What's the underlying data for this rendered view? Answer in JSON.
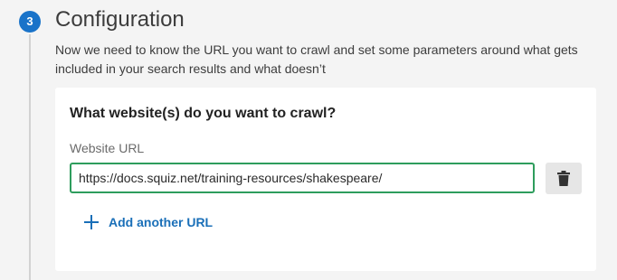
{
  "step": {
    "number": "3",
    "title": "Configuration",
    "description": "Now we need to know the URL you want to crawl and set some parameters around what gets included in your search results and what doesn’t"
  },
  "crawl_card": {
    "heading": "What website(s) do you want to crawl?",
    "url_field": {
      "label": "Website URL",
      "value": "https://docs.squiz.net/training-resources/shakespeare/"
    },
    "delete_icon": "trash-icon",
    "add_url": {
      "label": "Add another URL",
      "icon": "plus-icon"
    }
  },
  "colors": {
    "accent_blue": "#1a73c9",
    "input_focus_green": "#2e9d5d",
    "link_blue": "#1a6fb8"
  }
}
